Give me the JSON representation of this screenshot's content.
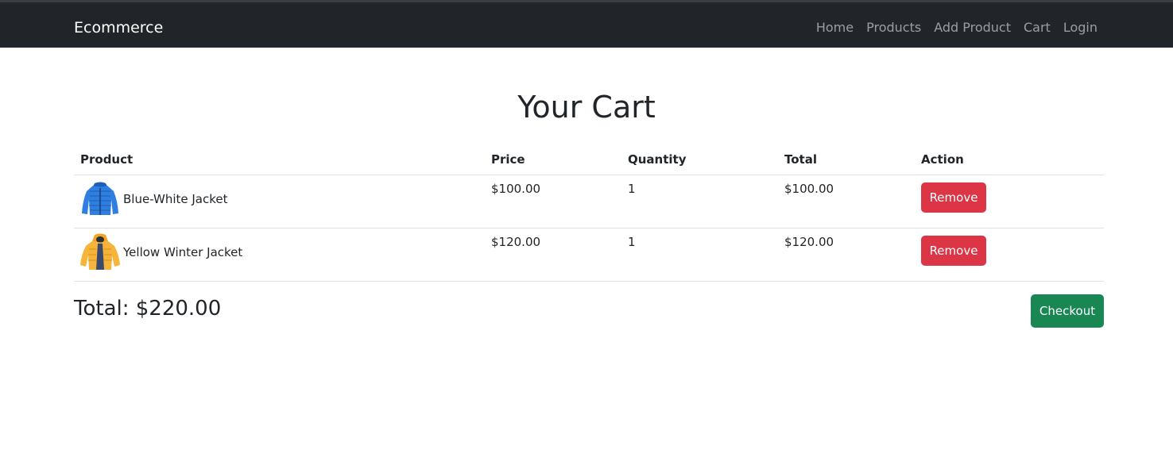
{
  "navbar": {
    "brand": "Ecommerce",
    "links": [
      "Home",
      "Products",
      "Add Product",
      "Cart",
      "Login"
    ]
  },
  "page": {
    "title": "Your Cart"
  },
  "table": {
    "headers": [
      "Product",
      "Price",
      "Quantity",
      "Total",
      "Action"
    ],
    "rows": [
      {
        "image_icon": "blue-jacket-image",
        "name": "Blue-White Jacket",
        "price": "$100.00",
        "quantity": "1",
        "total": "$100.00",
        "action_label": "Remove"
      },
      {
        "image_icon": "yellow-jacket-image",
        "name": "Yellow Winter Jacket",
        "price": "$120.00",
        "quantity": "1",
        "total": "$120.00",
        "action_label": "Remove"
      }
    ]
  },
  "summary": {
    "total_text": "Total: $220.00",
    "checkout_label": "Checkout"
  },
  "colors": {
    "navbar_bg": "#212529",
    "danger": "#dc3545",
    "success": "#198754"
  }
}
